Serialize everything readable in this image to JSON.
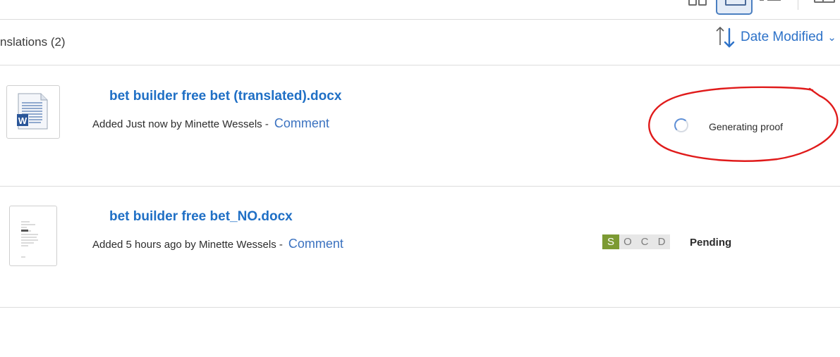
{
  "toolbar": {
    "views": [
      "grid-view",
      "card-view",
      "list-view",
      "panel-view"
    ],
    "active_view": "card-view"
  },
  "section": {
    "title": "nslations (2)"
  },
  "sort": {
    "label": "Date Modified",
    "accent": "#2d72c8"
  },
  "files": [
    {
      "name": "bet builder free bet (translated).docx",
      "meta": "Added Just now by Minette Wessels -",
      "comment": "Comment",
      "status": "Generating proof",
      "thumbnail": "word-doc-icon"
    },
    {
      "name": "bet builder free bet_NO.docx",
      "meta": "Added 5 hours ago by Minette Wessels -",
      "comment": "Comment",
      "workflow": {
        "steps": [
          "S",
          "O",
          "C",
          "D"
        ],
        "active_step": "S",
        "active_color": "#7c9a33"
      },
      "status": "Pending",
      "thumbnail": "document-preview"
    }
  ],
  "annotation": {
    "color": "#e01b1b"
  }
}
